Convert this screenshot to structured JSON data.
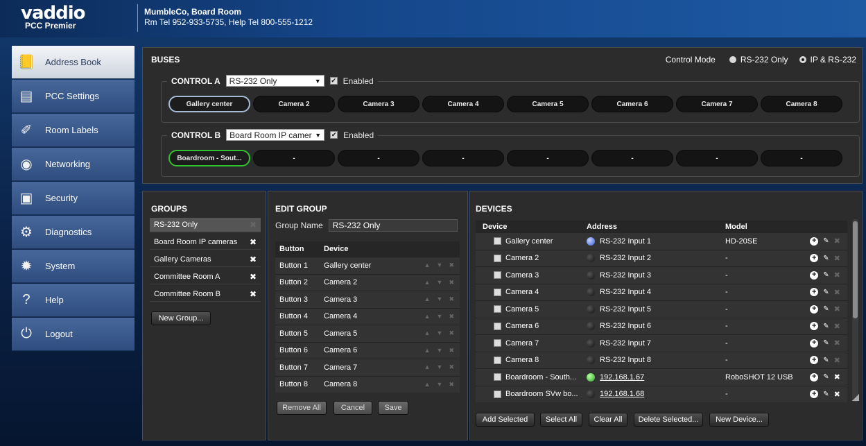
{
  "header": {
    "logo_text": "vaddio",
    "product": "PCC Premier",
    "site_name": "MumbleCo, Board Room",
    "site_contact": "Rm Tel 952-933-5735, Help Tel 800-555-1212"
  },
  "sidebar": {
    "items": [
      {
        "label": "Address Book",
        "icon": "address-book-icon",
        "active": true
      },
      {
        "label": "PCC Settings",
        "icon": "settings-icon"
      },
      {
        "label": "Room Labels",
        "icon": "label-icon"
      },
      {
        "label": "Networking",
        "icon": "network-icon"
      },
      {
        "label": "Security",
        "icon": "lock-icon"
      },
      {
        "label": "Diagnostics",
        "icon": "diagnostics-icon"
      },
      {
        "label": "System",
        "icon": "gears-icon"
      },
      {
        "label": "Help",
        "icon": "help-icon"
      },
      {
        "label": "Logout",
        "icon": "power-icon"
      }
    ]
  },
  "buses": {
    "title": "BUSES",
    "control_mode_label": "Control Mode",
    "mode_options": [
      "RS-232 Only",
      "IP & RS-232"
    ],
    "selected_mode": "IP & RS-232",
    "control_a": {
      "label": "CONTROL A",
      "group": "RS-232 Only",
      "enabled_label": "Enabled",
      "cameras": [
        "Gallery center",
        "Camera 2",
        "Camera 3",
        "Camera 4",
        "Camera 5",
        "Camera 6",
        "Camera 7",
        "Camera 8"
      ]
    },
    "control_b": {
      "label": "CONTROL B",
      "group": "Board Room IP camera",
      "enabled_label": "Enabled",
      "cameras": [
        "Boardroom - Sout...",
        "-",
        "-",
        "-",
        "-",
        "-",
        "-",
        "-"
      ]
    }
  },
  "groups": {
    "title": "GROUPS",
    "items": [
      "RS-232 Only",
      "Board Room IP cameras",
      "Gallery Cameras",
      "Committee Room A",
      "Committee Room B"
    ],
    "new_button": "New Group..."
  },
  "edit_group": {
    "title": "EDIT GROUP",
    "name_label": "Group Name",
    "name_value": "RS-232 Only",
    "headers": [
      "Button",
      "Device"
    ],
    "rows": [
      {
        "button": "Button 1",
        "device": "Gallery center"
      },
      {
        "button": "Button 2",
        "device": "Camera 2"
      },
      {
        "button": "Button 3",
        "device": "Camera 3"
      },
      {
        "button": "Button 4",
        "device": "Camera 4"
      },
      {
        "button": "Button 5",
        "device": "Camera 5"
      },
      {
        "button": "Button 6",
        "device": "Camera 6"
      },
      {
        "button": "Button 7",
        "device": "Camera 7"
      },
      {
        "button": "Button 8",
        "device": "Camera 8"
      }
    ],
    "buttons": {
      "remove_all": "Remove All",
      "cancel": "Cancel",
      "save": "Save"
    }
  },
  "devices": {
    "title": "DEVICES",
    "headers": [
      "Device",
      "Address",
      "Model"
    ],
    "rows": [
      {
        "device": "Gallery center",
        "address": "RS-232 Input 1",
        "model": "HD-20SE",
        "led": "blue"
      },
      {
        "device": "Camera 2",
        "address": "RS-232 Input 2",
        "model": "-",
        "led": "off"
      },
      {
        "device": "Camera 3",
        "address": "RS-232 Input 3",
        "model": "-",
        "led": "off"
      },
      {
        "device": "Camera 4",
        "address": "RS-232 Input 4",
        "model": "-",
        "led": "off"
      },
      {
        "device": "Camera 5",
        "address": "RS-232 Input 5",
        "model": "-",
        "led": "off"
      },
      {
        "device": "Camera 6",
        "address": "RS-232 Input 6",
        "model": "-",
        "led": "off"
      },
      {
        "device": "Camera 7",
        "address": "RS-232 Input 7",
        "model": "-",
        "led": "off"
      },
      {
        "device": "Camera 8",
        "address": "RS-232 Input 8",
        "model": "-",
        "led": "off"
      },
      {
        "device": "Boardroom - South...",
        "address": "192.168.1.67",
        "model": "RoboSHOT 12 USB",
        "led": "green"
      },
      {
        "device": "Boardroom SVw bo...",
        "address": "192.168.1.68",
        "model": "-",
        "led": "off"
      }
    ],
    "buttons": {
      "add_selected": "Add Selected",
      "select_all": "Select All",
      "clear_all": "Clear All",
      "delete_selected": "Delete Selected...",
      "new_device": "New Device..."
    }
  }
}
